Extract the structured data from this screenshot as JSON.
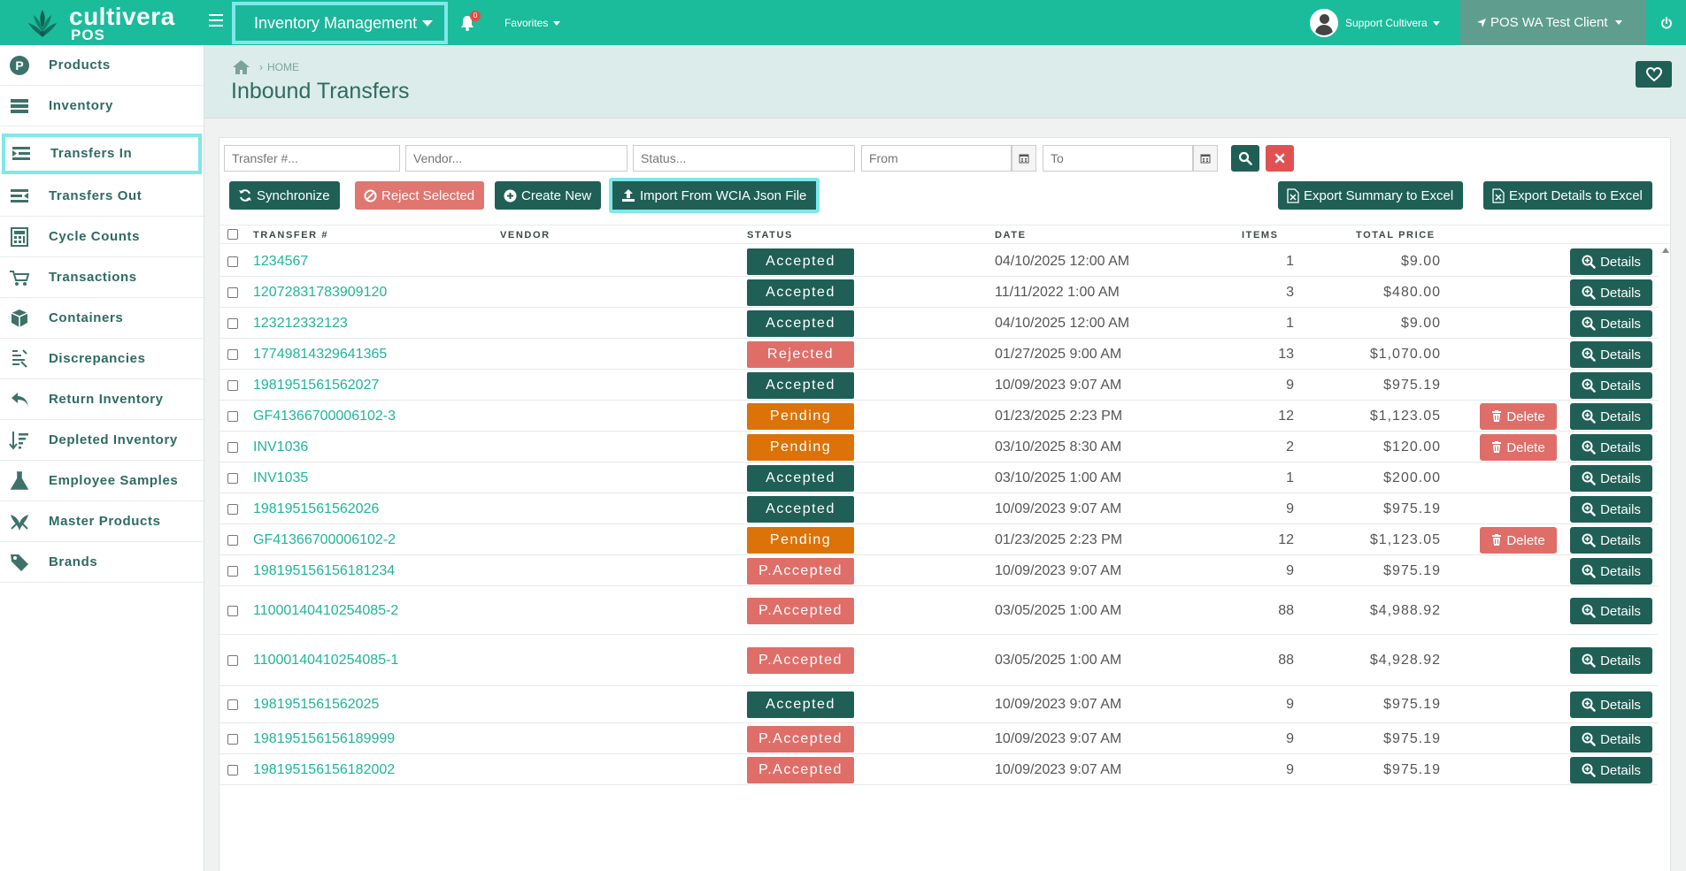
{
  "app": {
    "logo_text": "cultivera",
    "logo_sub": "POS",
    "module": "Inventory Management",
    "notification_count": "0",
    "favorites": "Favorites",
    "user": "Support Cultivera",
    "location": "POS WA Test Client"
  },
  "sidebar": {
    "items": [
      {
        "label": "Products",
        "icon": "products-icon"
      },
      {
        "label": "Inventory",
        "icon": "inventory-icon"
      },
      {
        "label": "Transfers In",
        "icon": "transfers-in-icon",
        "active": true
      },
      {
        "label": "Transfers Out",
        "icon": "transfers-out-icon"
      },
      {
        "label": "Cycle Counts",
        "icon": "calculator-icon"
      },
      {
        "label": "Transactions",
        "icon": "cart-icon"
      },
      {
        "label": "Containers",
        "icon": "box-icon"
      },
      {
        "label": "Discrepancies",
        "icon": "scale-icon"
      },
      {
        "label": "Return Inventory",
        "icon": "return-arrow-icon"
      },
      {
        "label": "Depleted Inventory",
        "icon": "sort-down-icon"
      },
      {
        "label": "Employee Samples",
        "icon": "flask-icon"
      },
      {
        "label": "Master Products",
        "icon": "leaf-icon"
      },
      {
        "label": "Brands",
        "icon": "tag-icon"
      }
    ]
  },
  "header": {
    "breadcrumb": "HOME",
    "title": "Inbound Transfers"
  },
  "filters": {
    "transfer_placeholder": "Transfer #...",
    "vendor_placeholder": "Vendor...",
    "status_placeholder": "Status...",
    "from_placeholder": "From",
    "to_placeholder": "To"
  },
  "actions": {
    "synchronize": "Synchronize",
    "reject_selected": "Reject Selected",
    "create_new": "Create New",
    "import_wcia": "Import From WCIA Json File",
    "export_summary": "Export Summary to Excel",
    "export_details": "Export Details to Excel"
  },
  "table": {
    "columns": [
      "TRANSFER #",
      "VENDOR",
      "STATUS",
      "DATE",
      "ITEMS",
      "TOTAL PRICE"
    ],
    "delete_label": "Delete",
    "details_label": "Details",
    "rows": [
      {
        "transfer": "1234567",
        "vendor": "",
        "status": "Accepted",
        "date": "04/10/2025 12:00 AM",
        "items": "1",
        "price": "$9.00",
        "deletable": false
      },
      {
        "transfer": "12072831783909120",
        "vendor": "",
        "status": "Accepted",
        "date": "11/11/2022 1:00 AM",
        "items": "3",
        "price": "$480.00",
        "deletable": false
      },
      {
        "transfer": "123212332123",
        "vendor": "",
        "status": "Accepted",
        "date": "04/10/2025 12:00 AM",
        "items": "1",
        "price": "$9.00",
        "deletable": false
      },
      {
        "transfer": "17749814329641365",
        "vendor": "",
        "status": "Rejected",
        "date": "01/27/2025 9:00 AM",
        "items": "13",
        "price": "$1,070.00",
        "deletable": false
      },
      {
        "transfer": "1981951561562027",
        "vendor": "",
        "status": "Accepted",
        "date": "10/09/2023 9:07 AM",
        "items": "9",
        "price": "$975.19",
        "deletable": false
      },
      {
        "transfer": "GF41366700006102-3",
        "vendor": "",
        "status": "Pending",
        "date": "01/23/2025 2:23 PM",
        "items": "12",
        "price": "$1,123.05",
        "deletable": true
      },
      {
        "transfer": "INV1036",
        "vendor": "",
        "status": "Pending",
        "date": "03/10/2025 8:30 AM",
        "items": "2",
        "price": "$120.00",
        "deletable": true
      },
      {
        "transfer": "INV1035",
        "vendor": "",
        "status": "Accepted",
        "date": "03/10/2025 1:00 AM",
        "items": "1",
        "price": "$200.00",
        "deletable": false
      },
      {
        "transfer": "1981951561562026",
        "vendor": "",
        "status": "Accepted",
        "date": "10/09/2023 9:07 AM",
        "items": "9",
        "price": "$975.19",
        "deletable": false
      },
      {
        "transfer": "GF41366700006102-2",
        "vendor": "",
        "status": "Pending",
        "date": "01/23/2025 2:23 PM",
        "items": "12",
        "price": "$1,123.05",
        "deletable": true
      },
      {
        "transfer": "198195156156181234",
        "vendor": "",
        "status": "P.Accepted",
        "date": "10/09/2023 9:07 AM",
        "items": "9",
        "price": "$975.19",
        "deletable": false
      },
      {
        "transfer": "11000140410254085-2",
        "vendor": "",
        "status": "P.Accepted",
        "date": "03/05/2025 1:00 AM",
        "items": "88",
        "price": "$4,988.92",
        "deletable": false
      },
      {
        "transfer": "11000140410254085-1",
        "vendor": "",
        "status": "P.Accepted",
        "date": "03/05/2025 1:00 AM",
        "items": "88",
        "price": "$4,928.92",
        "deletable": false
      },
      {
        "transfer": "1981951561562025",
        "vendor": "",
        "status": "Accepted",
        "date": "10/09/2023 9:07 AM",
        "items": "9",
        "price": "$975.19",
        "deletable": false
      },
      {
        "transfer": "198195156156189999",
        "vendor": "",
        "status": "P.Accepted",
        "date": "10/09/2023 9:07 AM",
        "items": "9",
        "price": "$975.19",
        "deletable": false
      },
      {
        "transfer": "198195156156182002",
        "vendor": "",
        "status": "P.Accepted",
        "date": "10/09/2023 9:07 AM",
        "items": "9",
        "price": "$975.19",
        "deletable": false
      }
    ]
  },
  "colors": {
    "brand": "#1abc9c",
    "dark": "#1f5f56",
    "danger": "#df6e68",
    "pending": "#db7309",
    "highlight": "#7fe8e8"
  }
}
